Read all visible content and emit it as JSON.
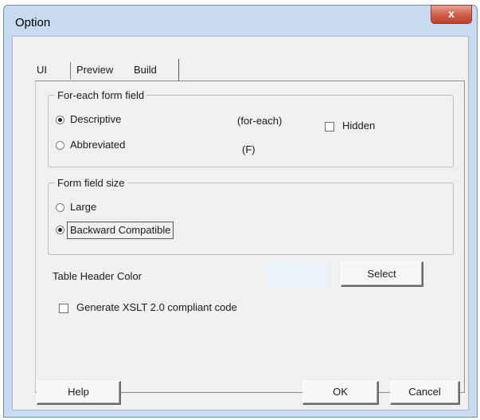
{
  "window": {
    "title": "Option",
    "close_symbol": "x"
  },
  "tabs": [
    {
      "label": "UI",
      "selected": false
    },
    {
      "label": "Preview",
      "selected": false
    },
    {
      "label": "Build",
      "selected": true
    }
  ],
  "foreach_group": {
    "legend": "For-each form field",
    "options": [
      {
        "label": "Descriptive",
        "checked": true
      },
      {
        "label": "Abbreviated",
        "checked": false
      }
    ],
    "hints": [
      "(for-each)",
      "(F)"
    ],
    "hidden_label": "Hidden",
    "hidden_checked": false
  },
  "size_group": {
    "legend": "Form field size",
    "options": [
      {
        "label": "Large",
        "checked": false
      },
      {
        "label": "Backward Compatible",
        "checked": true
      }
    ]
  },
  "table_header": {
    "label": "Table Header Color",
    "color": "#eaf2fb",
    "select_label": "Select"
  },
  "xslt": {
    "label": "Generate XSLT 2.0 compliant code",
    "checked": false
  },
  "footer": {
    "help_label": "Help",
    "ok_label": "OK",
    "cancel_label": "Cancel"
  }
}
